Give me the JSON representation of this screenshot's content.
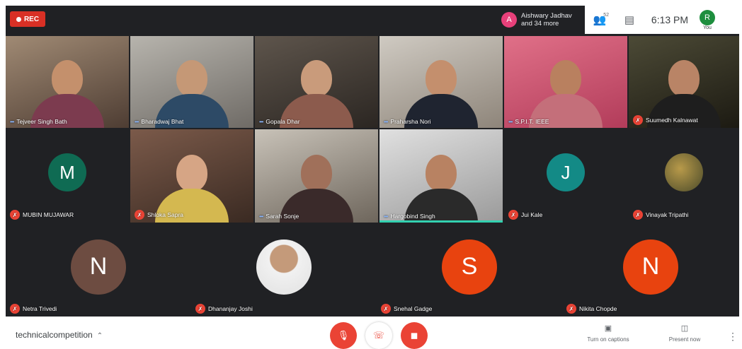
{
  "header": {
    "rec_label": "REC",
    "presenting_avatar_letter": "A",
    "presenting_name": "Aishwary Jadhav",
    "presenting_more": "and 34 more",
    "participants_count": "52",
    "time": "6:13 PM",
    "self_label": "You",
    "self_avatar_letter": "R"
  },
  "tiles": [
    {
      "name": "Tejveer Singh Bath",
      "mic": "on"
    },
    {
      "name": "Bharadwaj Bhat",
      "mic": "on"
    },
    {
      "name": "Gopala Dhar",
      "mic": "on"
    },
    {
      "name": "Praharsha Nori",
      "mic": "on"
    },
    {
      "name": "S.P.I.T. IEEE",
      "mic": "on"
    },
    {
      "name": "Suumedh Kalnawat",
      "mic": "off"
    },
    {
      "name": "MUBIN MUJAWAR",
      "mic": "off",
      "avatar_letter": "M",
      "avatar_color": "#0f6b53"
    },
    {
      "name": "Shloka Sapra",
      "mic": "off"
    },
    {
      "name": "Sarah Sonje",
      "mic": "on"
    },
    {
      "name": "Hargobind Singh",
      "mic": "on",
      "speaking": true
    },
    {
      "name": "Jui Kale",
      "mic": "off",
      "avatar_letter": "J",
      "avatar_color": "#138a86"
    },
    {
      "name": "Vinayak Tripathi",
      "mic": "off"
    },
    {
      "name": "Netra Trivedi",
      "mic": "off",
      "avatar_letter": "N",
      "avatar_color": "#6d4c41"
    },
    {
      "name": "Dhananjay Joshi",
      "mic": "off"
    },
    {
      "name": "Snehal Gadge",
      "mic": "off",
      "avatar_letter": "S",
      "avatar_color": "#e8430f"
    },
    {
      "name": "Nikita Chopde",
      "mic": "off",
      "avatar_letter": "N",
      "avatar_color": "#e8430f"
    }
  ],
  "footer": {
    "meeting_code": "technicalcompetition",
    "captions_label": "Turn on captions",
    "present_label": "Present now"
  },
  "icons": {
    "rec": "rec-dot-icon",
    "people": "people-icon",
    "chat": "chat-icon",
    "mic_off": "mic-off-icon",
    "mic_on": "audio-level-icon",
    "hangup": "phone-hangup-icon",
    "cam_off": "camera-off-icon",
    "captions": "captions-icon",
    "present": "present-screen-icon",
    "more": "more-vert-icon",
    "expand": "chevron-up-icon"
  },
  "colors": {
    "grid_bg": "#202124",
    "danger": "#ea4335",
    "speaking": "#33d1b0",
    "self_avatar": "#1e8e3e"
  }
}
